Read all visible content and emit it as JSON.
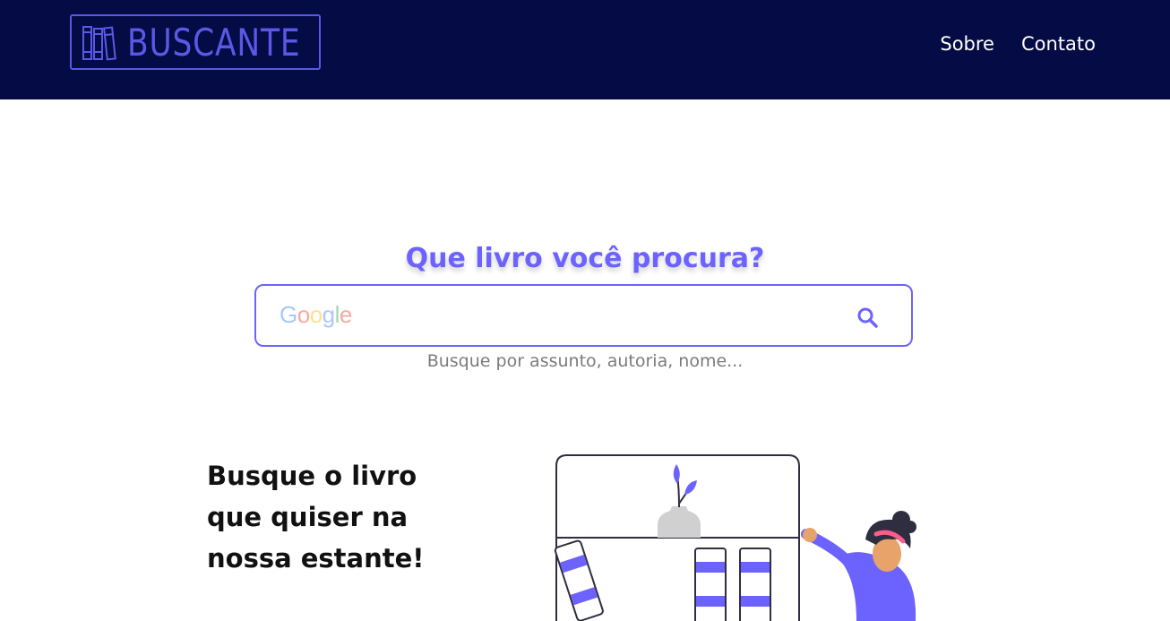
{
  "header": {
    "logo_text": "BUSCANTE",
    "nav": [
      {
        "label": "Sobre"
      },
      {
        "label": "Contato"
      }
    ]
  },
  "search": {
    "title": "Que livro você procura?",
    "engine_brand": [
      "G",
      "o",
      "o",
      "g",
      "l",
      "e"
    ],
    "placeholder": "",
    "hint": "Busque por assunto, autoria, nome..."
  },
  "promo": {
    "line1": "Busque o livro",
    "line2": "que quiser na",
    "line3": "nossa estante!"
  },
  "colors": {
    "header_bg": "#050b45",
    "accent": "#6c63ff",
    "logo": "#5b58e6"
  },
  "icons": {
    "logo": "books-icon",
    "search": "magnifier-icon"
  }
}
